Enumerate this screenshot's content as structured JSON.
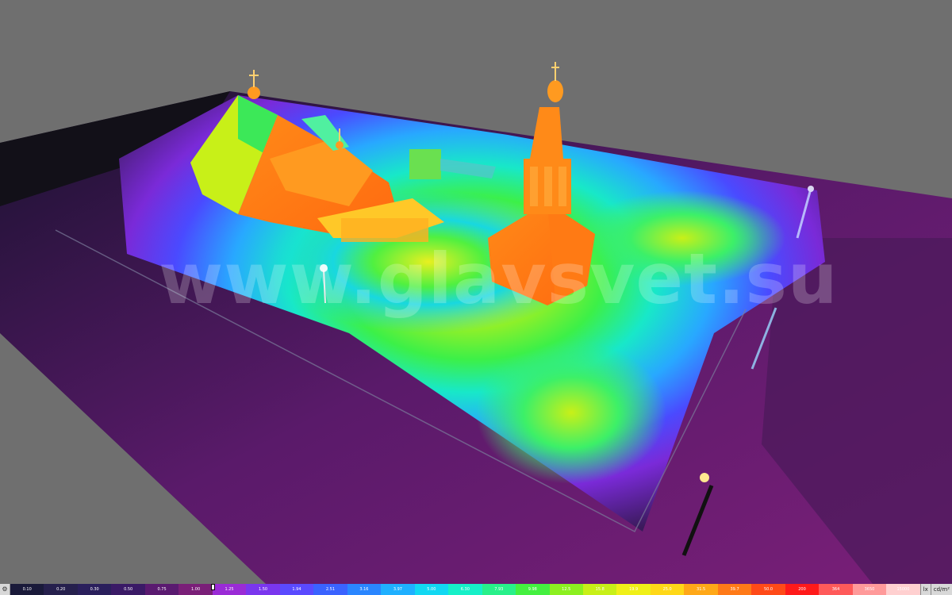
{
  "watermark": "www.glavsvet.su",
  "scale": {
    "labels": [
      "0.10",
      "0.20",
      "0.30",
      "0.50",
      "0.75",
      "1.00",
      "1.25",
      "1.50",
      "1.94",
      "2.51",
      "3.16",
      "3.97",
      "5.00",
      "6.30",
      "7.93",
      "9.98",
      "12.5",
      "15.8",
      "19.9",
      "25.0",
      "31.5",
      "39.7",
      "50.0",
      "200",
      "364",
      "3650",
      "15000"
    ],
    "colors": [
      "#1a1a3a",
      "#26204d",
      "#2a1f5c",
      "#3a1a66",
      "#5a1a70",
      "#7a1f78",
      "#9a2bd6",
      "#7a36ee",
      "#5a4aff",
      "#3a63ff",
      "#2a86ff",
      "#1fb0ff",
      "#12d8f2",
      "#16f0c8",
      "#28f08a",
      "#44f040",
      "#8cf020",
      "#c8f018",
      "#f0f018",
      "#ffd818",
      "#ffa818",
      "#ff7a18",
      "#ff4a18",
      "#ff1a1a",
      "#ff5a5a",
      "#ff9a9a",
      "#ffd0d0"
    ],
    "marker_value": "1.00",
    "unit_lx": "lx",
    "unit_cdm": "cd/m²"
  }
}
